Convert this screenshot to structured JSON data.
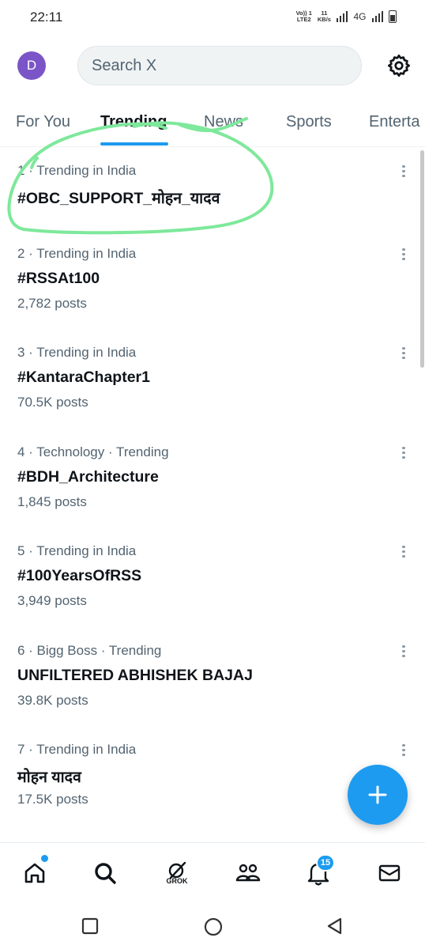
{
  "status_bar": {
    "time": "22:11",
    "volte_top": "Vo)) 1",
    "volte_bottom": "LTE2",
    "speed_top": "11",
    "speed_bottom": "KB/s",
    "network": "4G"
  },
  "header": {
    "avatar_letter": "D",
    "avatar_color": "#7b55c7",
    "search_placeholder": "Search X",
    "settings_icon": "gear-icon"
  },
  "tabs": [
    {
      "label": "For You",
      "active": false
    },
    {
      "label": "Trending",
      "active": true
    },
    {
      "label": "News",
      "active": false
    },
    {
      "label": "Sports",
      "active": false
    },
    {
      "label": "Enterta",
      "active": false
    }
  ],
  "trends": [
    {
      "meta": "1 · Trending in India",
      "title": "#OBC_SUPPORT_मोहन_यादव",
      "posts": ""
    },
    {
      "meta": "2 · Trending in India",
      "title": "#RSSAt100",
      "posts": "2,782 posts"
    },
    {
      "meta": "3 · Trending in India",
      "title": "#KantaraChapter1",
      "posts": "70.5K posts"
    },
    {
      "meta": "4 · Technology · Trending",
      "title": "#BDH_Architecture",
      "posts": "1,845 posts"
    },
    {
      "meta": "5 · Trending in India",
      "title": "#100YearsOfRSS",
      "posts": "3,949 posts"
    },
    {
      "meta": "6 · Bigg Boss · Trending",
      "title": "UNFILTERED ABHISHEK BAJAJ",
      "posts": "39.8K posts"
    },
    {
      "meta": "7 · Trending in India",
      "title": "मोहन यादव",
      "posts": "17.5K posts"
    }
  ],
  "bottom_nav": {
    "grok_label": "GROK",
    "notifications_badge": "15"
  },
  "colors": {
    "accent": "#1d9bf0",
    "scribble": "#7ee89b",
    "secondary_text": "#536471"
  }
}
